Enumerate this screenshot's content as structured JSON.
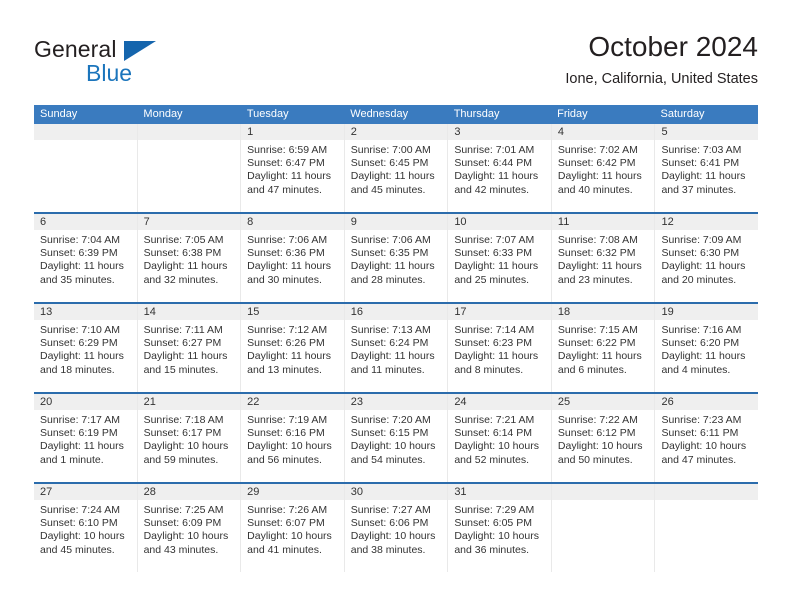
{
  "logo": {
    "word1": "General",
    "word2": "Blue",
    "triangle_color": "#1565ad",
    "word2_color": "#1b75bc"
  },
  "header": {
    "title": "October 2024",
    "subtitle": "Ione, California, United States"
  },
  "calendar": {
    "header_bg": "#3a7bbf",
    "separator_color": "#2b6cac",
    "daynum_bg": "#efefef",
    "weekdays": [
      "Sunday",
      "Monday",
      "Tuesday",
      "Wednesday",
      "Thursday",
      "Friday",
      "Saturday"
    ],
    "weeks": [
      [
        {
          "day": "",
          "sunrise": "",
          "sunset": "",
          "daylight1": "",
          "daylight2": "",
          "empty": true
        },
        {
          "day": "",
          "sunrise": "",
          "sunset": "",
          "daylight1": "",
          "daylight2": "",
          "empty": true
        },
        {
          "day": "1",
          "sunrise": "Sunrise: 6:59 AM",
          "sunset": "Sunset: 6:47 PM",
          "daylight1": "Daylight: 11 hours",
          "daylight2": "and 47 minutes."
        },
        {
          "day": "2",
          "sunrise": "Sunrise: 7:00 AM",
          "sunset": "Sunset: 6:45 PM",
          "daylight1": "Daylight: 11 hours",
          "daylight2": "and 45 minutes."
        },
        {
          "day": "3",
          "sunrise": "Sunrise: 7:01 AM",
          "sunset": "Sunset: 6:44 PM",
          "daylight1": "Daylight: 11 hours",
          "daylight2": "and 42 minutes."
        },
        {
          "day": "4",
          "sunrise": "Sunrise: 7:02 AM",
          "sunset": "Sunset: 6:42 PM",
          "daylight1": "Daylight: 11 hours",
          "daylight2": "and 40 minutes."
        },
        {
          "day": "5",
          "sunrise": "Sunrise: 7:03 AM",
          "sunset": "Sunset: 6:41 PM",
          "daylight1": "Daylight: 11 hours",
          "daylight2": "and 37 minutes."
        }
      ],
      [
        {
          "day": "6",
          "sunrise": "Sunrise: 7:04 AM",
          "sunset": "Sunset: 6:39 PM",
          "daylight1": "Daylight: 11 hours",
          "daylight2": "and 35 minutes."
        },
        {
          "day": "7",
          "sunrise": "Sunrise: 7:05 AM",
          "sunset": "Sunset: 6:38 PM",
          "daylight1": "Daylight: 11 hours",
          "daylight2": "and 32 minutes."
        },
        {
          "day": "8",
          "sunrise": "Sunrise: 7:06 AM",
          "sunset": "Sunset: 6:36 PM",
          "daylight1": "Daylight: 11 hours",
          "daylight2": "and 30 minutes."
        },
        {
          "day": "9",
          "sunrise": "Sunrise: 7:06 AM",
          "sunset": "Sunset: 6:35 PM",
          "daylight1": "Daylight: 11 hours",
          "daylight2": "and 28 minutes."
        },
        {
          "day": "10",
          "sunrise": "Sunrise: 7:07 AM",
          "sunset": "Sunset: 6:33 PM",
          "daylight1": "Daylight: 11 hours",
          "daylight2": "and 25 minutes."
        },
        {
          "day": "11",
          "sunrise": "Sunrise: 7:08 AM",
          "sunset": "Sunset: 6:32 PM",
          "daylight1": "Daylight: 11 hours",
          "daylight2": "and 23 minutes."
        },
        {
          "day": "12",
          "sunrise": "Sunrise: 7:09 AM",
          "sunset": "Sunset: 6:30 PM",
          "daylight1": "Daylight: 11 hours",
          "daylight2": "and 20 minutes."
        }
      ],
      [
        {
          "day": "13",
          "sunrise": "Sunrise: 7:10 AM",
          "sunset": "Sunset: 6:29 PM",
          "daylight1": "Daylight: 11 hours",
          "daylight2": "and 18 minutes."
        },
        {
          "day": "14",
          "sunrise": "Sunrise: 7:11 AM",
          "sunset": "Sunset: 6:27 PM",
          "daylight1": "Daylight: 11 hours",
          "daylight2": "and 15 minutes."
        },
        {
          "day": "15",
          "sunrise": "Sunrise: 7:12 AM",
          "sunset": "Sunset: 6:26 PM",
          "daylight1": "Daylight: 11 hours",
          "daylight2": "and 13 minutes."
        },
        {
          "day": "16",
          "sunrise": "Sunrise: 7:13 AM",
          "sunset": "Sunset: 6:24 PM",
          "daylight1": "Daylight: 11 hours",
          "daylight2": "and 11 minutes."
        },
        {
          "day": "17",
          "sunrise": "Sunrise: 7:14 AM",
          "sunset": "Sunset: 6:23 PM",
          "daylight1": "Daylight: 11 hours",
          "daylight2": "and 8 minutes."
        },
        {
          "day": "18",
          "sunrise": "Sunrise: 7:15 AM",
          "sunset": "Sunset: 6:22 PM",
          "daylight1": "Daylight: 11 hours",
          "daylight2": "and 6 minutes."
        },
        {
          "day": "19",
          "sunrise": "Sunrise: 7:16 AM",
          "sunset": "Sunset: 6:20 PM",
          "daylight1": "Daylight: 11 hours",
          "daylight2": "and 4 minutes."
        }
      ],
      [
        {
          "day": "20",
          "sunrise": "Sunrise: 7:17 AM",
          "sunset": "Sunset: 6:19 PM",
          "daylight1": "Daylight: 11 hours",
          "daylight2": "and 1 minute."
        },
        {
          "day": "21",
          "sunrise": "Sunrise: 7:18 AM",
          "sunset": "Sunset: 6:17 PM",
          "daylight1": "Daylight: 10 hours",
          "daylight2": "and 59 minutes."
        },
        {
          "day": "22",
          "sunrise": "Sunrise: 7:19 AM",
          "sunset": "Sunset: 6:16 PM",
          "daylight1": "Daylight: 10 hours",
          "daylight2": "and 56 minutes."
        },
        {
          "day": "23",
          "sunrise": "Sunrise: 7:20 AM",
          "sunset": "Sunset: 6:15 PM",
          "daylight1": "Daylight: 10 hours",
          "daylight2": "and 54 minutes."
        },
        {
          "day": "24",
          "sunrise": "Sunrise: 7:21 AM",
          "sunset": "Sunset: 6:14 PM",
          "daylight1": "Daylight: 10 hours",
          "daylight2": "and 52 minutes."
        },
        {
          "day": "25",
          "sunrise": "Sunrise: 7:22 AM",
          "sunset": "Sunset: 6:12 PM",
          "daylight1": "Daylight: 10 hours",
          "daylight2": "and 50 minutes."
        },
        {
          "day": "26",
          "sunrise": "Sunrise: 7:23 AM",
          "sunset": "Sunset: 6:11 PM",
          "daylight1": "Daylight: 10 hours",
          "daylight2": "and 47 minutes."
        }
      ],
      [
        {
          "day": "27",
          "sunrise": "Sunrise: 7:24 AM",
          "sunset": "Sunset: 6:10 PM",
          "daylight1": "Daylight: 10 hours",
          "daylight2": "and 45 minutes."
        },
        {
          "day": "28",
          "sunrise": "Sunrise: 7:25 AM",
          "sunset": "Sunset: 6:09 PM",
          "daylight1": "Daylight: 10 hours",
          "daylight2": "and 43 minutes."
        },
        {
          "day": "29",
          "sunrise": "Sunrise: 7:26 AM",
          "sunset": "Sunset: 6:07 PM",
          "daylight1": "Daylight: 10 hours",
          "daylight2": "and 41 minutes."
        },
        {
          "day": "30",
          "sunrise": "Sunrise: 7:27 AM",
          "sunset": "Sunset: 6:06 PM",
          "daylight1": "Daylight: 10 hours",
          "daylight2": "and 38 minutes."
        },
        {
          "day": "31",
          "sunrise": "Sunrise: 7:29 AM",
          "sunset": "Sunset: 6:05 PM",
          "daylight1": "Daylight: 10 hours",
          "daylight2": "and 36 minutes."
        },
        {
          "day": "",
          "sunrise": "",
          "sunset": "",
          "daylight1": "",
          "daylight2": "",
          "empty": true
        },
        {
          "day": "",
          "sunrise": "",
          "sunset": "",
          "daylight1": "",
          "daylight2": "",
          "empty": true
        }
      ]
    ]
  }
}
